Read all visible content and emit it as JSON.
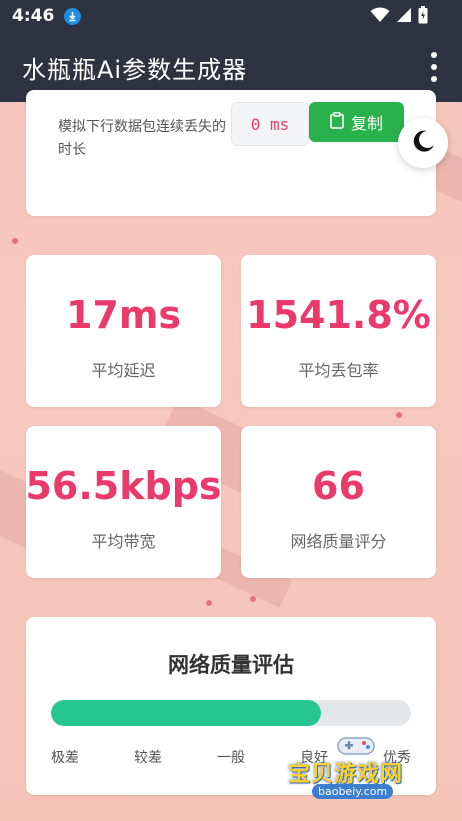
{
  "status_bar": {
    "time": "4:46"
  },
  "app_bar": {
    "title": "水瓶瓶Ai参数生成器"
  },
  "top_card": {
    "description": "模拟下行数据包连续丢失的时长",
    "value": "0 ms",
    "copy_label": "复制"
  },
  "stats": [
    {
      "value": "17ms",
      "label": "平均延迟"
    },
    {
      "value": "1541.8%",
      "label": "平均丢包率"
    },
    {
      "value": "56.5kbps",
      "label": "平均带宽"
    },
    {
      "value": "66",
      "label": "网络质量评分"
    }
  ],
  "quality": {
    "title": "网络质量评估",
    "level_percent": 75,
    "scale": [
      "极差",
      "较差",
      "一般",
      "良好",
      "优秀"
    ]
  },
  "watermark": {
    "text": "宝贝游戏网",
    "url": "baobeiy.com"
  },
  "colors": {
    "app_bar": "#2f3241",
    "accent_number": "#e93a6b",
    "copy_button": "#29b14c",
    "progress_fill": "#25c690",
    "background": "#f7c4bb"
  },
  "icons": {
    "download": "download-icon",
    "wifi": "wifi-icon",
    "signal": "signal-icon",
    "battery": "battery-icon",
    "menu": "more-vert-icon",
    "copy": "clipboard-icon",
    "theme": "moon-icon"
  }
}
